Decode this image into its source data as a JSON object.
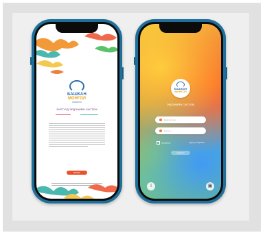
{
  "left_screen": {
    "logo": {
      "word1": "БАШКАН",
      "word2": "МОНГОЛ",
      "sub": "ХАРАТОО"
    },
    "title": "БУРГУУД ЭРДЭНИЙН СИСТЕМ",
    "button_label": "ЭХЛЭХ",
    "icons": [
      "cloud-ornament-icon",
      "logo-icon"
    ]
  },
  "right_screen": {
    "logo": {
      "word1": "БАШКАН",
      "word2": "МОНГОЛ"
    },
    "title": "ЭРДЭНИЙН СИСТЕМ",
    "username_placeholder": "Нэвтрэх нэр",
    "password_placeholder": "Нууц үг",
    "remember_label": "Сануулах",
    "forgot_label": "Нууц үг мартсан",
    "login_label": "Нэвтрэх",
    "bottom_left_icon": "info-icon",
    "bottom_right_icon": "gallery-icon"
  },
  "colors": {
    "phone_frame": "#1e6f9a",
    "accent_red": "#e9502e",
    "logo_blue": "#2a69b0",
    "logo_gold": "#e8a31a"
  }
}
